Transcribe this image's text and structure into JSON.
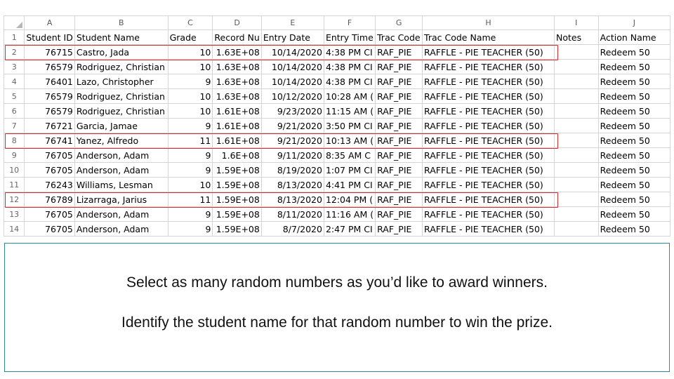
{
  "column_letters": [
    "A",
    "B",
    "C",
    "D",
    "E",
    "F",
    "G",
    "H",
    "I",
    "J"
  ],
  "header_row": {
    "row_number": "1",
    "cells": [
      "Student ID",
      "Student Name",
      "Grade",
      "Record Nu",
      "Entry Date",
      "Entry Time",
      "Trac Code",
      "Trac Code Name",
      "Notes",
      "Action Name"
    ]
  },
  "rows": [
    {
      "n": "2",
      "id": "76715",
      "name": "Castro, Jada",
      "grade": "10",
      "record": "1.63E+08",
      "date": "10/14/2020",
      "time": "4:38 PM CI",
      "code": "RAF_PIE",
      "code_name": "RAFFLE - PIE TEACHER (50)",
      "notes": "",
      "action": "Redeem 50"
    },
    {
      "n": "3",
      "id": "76579",
      "name": "Rodriguez, Christian",
      "grade": "10",
      "record": "1.63E+08",
      "date": "10/14/2020",
      "time": "4:38 PM CI",
      "code": "RAF_PIE",
      "code_name": "RAFFLE - PIE TEACHER (50)",
      "notes": "",
      "action": "Redeem 50"
    },
    {
      "n": "4",
      "id": "76401",
      "name": "Lazo, Christopher",
      "grade": "9",
      "record": "1.63E+08",
      "date": "10/14/2020",
      "time": "4:38 PM CI",
      "code": "RAF_PIE",
      "code_name": "RAFFLE - PIE TEACHER (50)",
      "notes": "",
      "action": "Redeem 50"
    },
    {
      "n": "5",
      "id": "76579",
      "name": "Rodriguez, Christian",
      "grade": "10",
      "record": "1.63E+08",
      "date": "10/12/2020",
      "time": "10:28 AM (",
      "code": "RAF_PIE",
      "code_name": "RAFFLE - PIE TEACHER (50)",
      "notes": "",
      "action": "Redeem 50"
    },
    {
      "n": "6",
      "id": "76579",
      "name": "Rodriguez, Christian",
      "grade": "10",
      "record": "1.61E+08",
      "date": "9/23/2020",
      "time": "11:15 AM (",
      "code": "RAF_PIE",
      "code_name": "RAFFLE - PIE TEACHER (50)",
      "notes": "",
      "action": "Redeem 50"
    },
    {
      "n": "7",
      "id": "76721",
      "name": "Garcia, Jamae",
      "grade": "9",
      "record": "1.61E+08",
      "date": "9/21/2020",
      "time": "3:50 PM CI",
      "code": "RAF_PIE",
      "code_name": "RAFFLE - PIE TEACHER (50)",
      "notes": "",
      "action": "Redeem 50"
    },
    {
      "n": "8",
      "id": "76741",
      "name": "Yanez, Alfredo",
      "grade": "11",
      "record": "1.61E+08",
      "date": "9/21/2020",
      "time": "10:13 AM (",
      "code": "RAF_PIE",
      "code_name": "RAFFLE - PIE TEACHER (50)",
      "notes": "",
      "action": "Redeem 50"
    },
    {
      "n": "9",
      "id": "76705",
      "name": "Anderson, Adam",
      "grade": "9",
      "record": "1.6E+08",
      "date": "9/11/2020",
      "time": "8:35 AM C",
      "code": "RAF_PIE",
      "code_name": "RAFFLE - PIE TEACHER (50)",
      "notes": "",
      "action": "Redeem 50"
    },
    {
      "n": "10",
      "id": "76705",
      "name": "Anderson, Adam",
      "grade": "9",
      "record": "1.59E+08",
      "date": "8/19/2020",
      "time": "1:07 PM CI",
      "code": "RAF_PIE",
      "code_name": "RAFFLE - PIE TEACHER (50)",
      "notes": "",
      "action": "Redeem 50"
    },
    {
      "n": "11",
      "id": "76243",
      "name": "Williams, Lesman",
      "grade": "10",
      "record": "1.59E+08",
      "date": "8/13/2020",
      "time": "4:41 PM CI",
      "code": "RAF_PIE",
      "code_name": "RAFFLE - PIE TEACHER (50)",
      "notes": "",
      "action": "Redeem 50"
    },
    {
      "n": "12",
      "id": "76789",
      "name": "Lizarraga, Jarius",
      "grade": "11",
      "record": "1.59E+08",
      "date": "8/13/2020",
      "time": "12:04 PM (",
      "code": "RAF_PIE",
      "code_name": "RAFFLE - PIE TEACHER (50)",
      "notes": "",
      "action": "Redeem 50"
    },
    {
      "n": "13",
      "id": "76705",
      "name": "Anderson, Adam",
      "grade": "9",
      "record": "1.59E+08",
      "date": "8/11/2020",
      "time": "11:16 AM (",
      "code": "RAF_PIE",
      "code_name": "RAFFLE - PIE TEACHER (50)",
      "notes": "",
      "action": "Redeem 50"
    },
    {
      "n": "14",
      "id": "76705",
      "name": "Anderson, Adam",
      "grade": "9",
      "record": "1.59E+08",
      "date": "8/7/2020",
      "time": "2:47 PM CI",
      "code": "RAF_PIE",
      "code_name": "RAFFLE - PIE TEACHER (50)",
      "notes": "",
      "action": "Redeem 50"
    }
  ],
  "highlighted_rows": [
    "2",
    "8",
    "12"
  ],
  "highlight_color": "#d62e2e",
  "panel": {
    "border_color": "#2a8a96",
    "line1": "Select as many random numbers as you’d like to award winners.",
    "line2": "Identify the student name for that random number to win the prize."
  }
}
